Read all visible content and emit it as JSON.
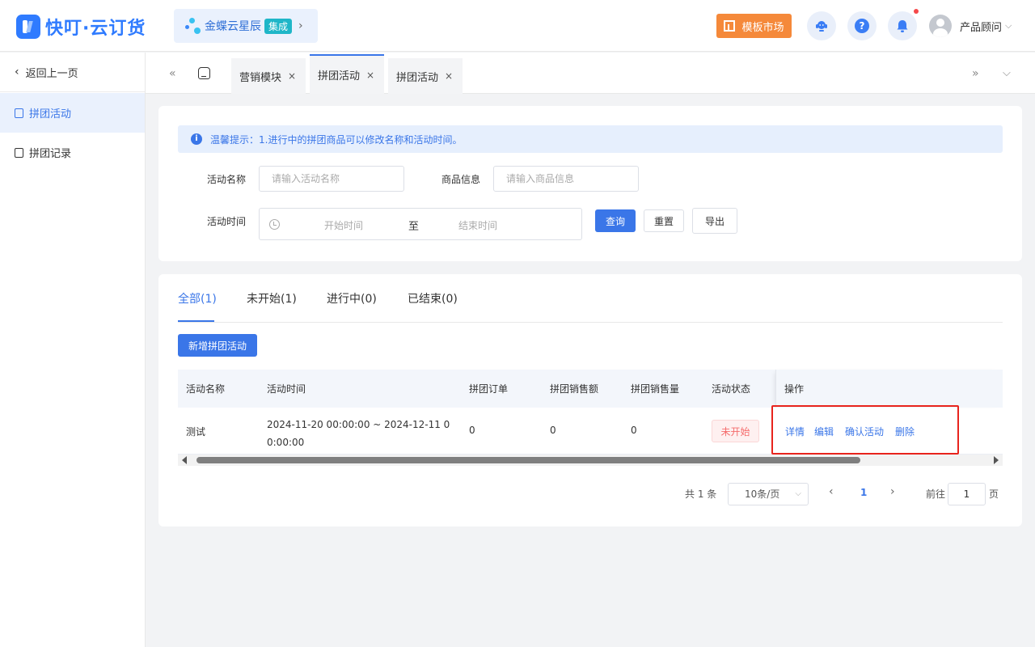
{
  "header": {
    "logo_text": "快叮·云订货",
    "kingdee": {
      "label": "金蝶云星辰",
      "badge": "集成",
      "arrow": "›"
    },
    "market_label": "模板市场",
    "help_glyph": "?",
    "user_name": "产品顾问",
    "user_caret": "⌵"
  },
  "sidebar": {
    "back_label": "返回上一页",
    "items": [
      {
        "label": "拼团活动",
        "active": true
      },
      {
        "label": "拼团记录",
        "active": false
      }
    ]
  },
  "tabs_bar": {
    "left_nav": "«",
    "right_nav": "»",
    "dropdown": "⌵",
    "tabs": [
      {
        "label": "营销模块",
        "close": "×"
      },
      {
        "label": "拼团活动",
        "close": "×",
        "active": true
      },
      {
        "label": "拼团活动",
        "close": "×"
      }
    ]
  },
  "filter": {
    "tip": "温馨提示：1.进行中的拼团商品可以修改名称和活动时间。",
    "tip_icon": "i",
    "name_label": "活动名称",
    "name_placeholder": "请输入活动名称",
    "goods_label": "商品信息",
    "goods_placeholder": "请输入商品信息",
    "time_label": "活动时间",
    "start_placeholder": "开始时间",
    "separator": "至",
    "end_placeholder": "结束时间",
    "query_label": "查询",
    "reset_label": "重置",
    "export_label": "导出"
  },
  "list": {
    "status_tabs": [
      {
        "label": "全部(1)",
        "active": true
      },
      {
        "label": "未开始(1)"
      },
      {
        "label": "进行中(0)"
      },
      {
        "label": "已结束(0)"
      }
    ],
    "add_label": "新增拼团活动",
    "columns": [
      "活动名称",
      "活动时间",
      "拼团订单",
      "拼团销售额",
      "拼团销售量",
      "活动状态",
      "操作"
    ],
    "rows": [
      {
        "name": "测试",
        "time": "2024-11-20 00:00:00 ~ 2024-12-11 00:00:00",
        "orders": "0",
        "sales_amount": "0",
        "sales_qty": "0",
        "status": "未开始",
        "actions": [
          "详情",
          "编辑",
          "确认活动",
          "删除"
        ]
      }
    ],
    "pagination": {
      "total": "共 1 条",
      "page_size": "10条/页",
      "size_caret": "⌵",
      "prev": "‹",
      "current": "1",
      "next": "›",
      "goto_label": "前往",
      "goto_value": "1",
      "page_suffix": "页"
    }
  },
  "colors": {
    "primary": "#3a76e8",
    "market": "#f5893a",
    "status_pending": "#f56c6c",
    "highlight_box": "#e8241d"
  }
}
